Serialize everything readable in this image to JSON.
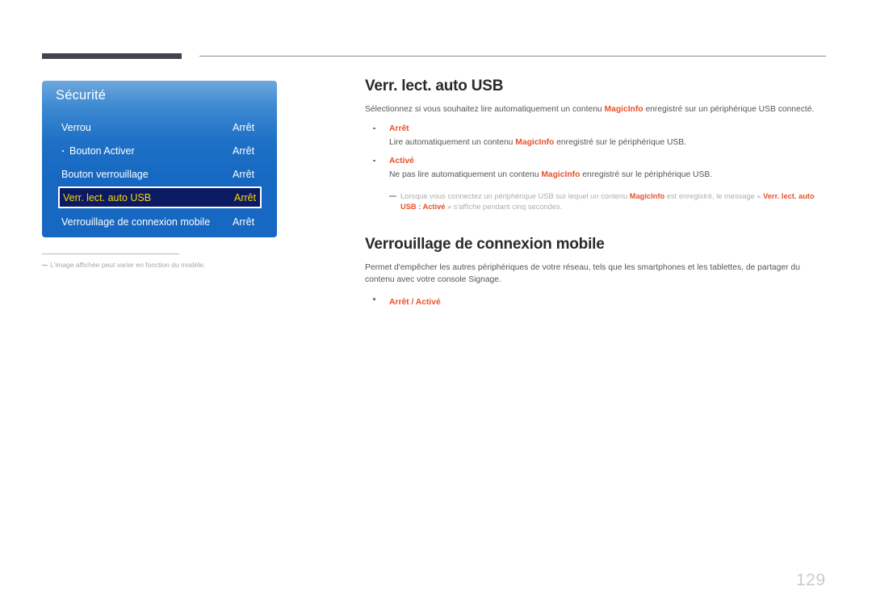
{
  "page": {
    "number": "129"
  },
  "osd": {
    "title": "Sécurité",
    "rows": [
      {
        "label": "Verrou",
        "value": "Arrêt",
        "sub": false,
        "selected": false
      },
      {
        "label": "Bouton Activer",
        "value": "Arrêt",
        "sub": true,
        "selected": false
      },
      {
        "label": "Bouton verrouillage",
        "value": "Arrêt",
        "sub": false,
        "selected": false
      },
      {
        "label": "Verr. lect. auto USB",
        "value": "Arrêt",
        "sub": false,
        "selected": true
      },
      {
        "label": "Verrouillage de connexion mobile",
        "value": "Arrêt",
        "sub": false,
        "selected": false
      }
    ],
    "footnote": "L'image affichée peut varier en fonction du modèle."
  },
  "sections": [
    {
      "title": "Verr. lect. auto USB",
      "intro_1": "Sélectionnez si vous souhaitez lire automatiquement un contenu ",
      "intro_hl": "MagicInfo",
      "intro_2": " enregistré sur un périphérique USB connecté.",
      "bullets": [
        {
          "head": "Arrêt",
          "desc_1": "Lire automatiquement un contenu ",
          "desc_hl": "MagicInfo",
          "desc_2": " enregistré sur le périphérique USB."
        },
        {
          "head": "Activé",
          "desc_1": "Ne pas lire automatiquement un contenu ",
          "desc_hl": "MagicInfo",
          "desc_2": " enregistré sur le périphérique USB."
        }
      ],
      "note_1": "Lorsque vous connectez un périphérique USB sur lequel un contenu ",
      "note_hl1": "MagicInfo",
      "note_2": " est enregistré, le message « ",
      "note_hl2": "Verr. lect. auto USB : Activé",
      "note_3": " » s'affiche pendant cinq secondes."
    },
    {
      "title": "Verrouillage de connexion mobile",
      "intro": "Permet d'empêcher les autres périphériques de votre réseau, tels que les smartphones et les tablettes, de partager du contenu avec votre console Signage.",
      "option": "Arrêt / Activé"
    }
  ],
  "colors": {
    "accent_orange": "#e8512a",
    "osd_blue": "#1668c2",
    "osd_selected_bg": "#0c1a63",
    "osd_selected_text": "#f7dc0a",
    "header_bar": "#46424f",
    "page_number": "#c9c9d2"
  }
}
